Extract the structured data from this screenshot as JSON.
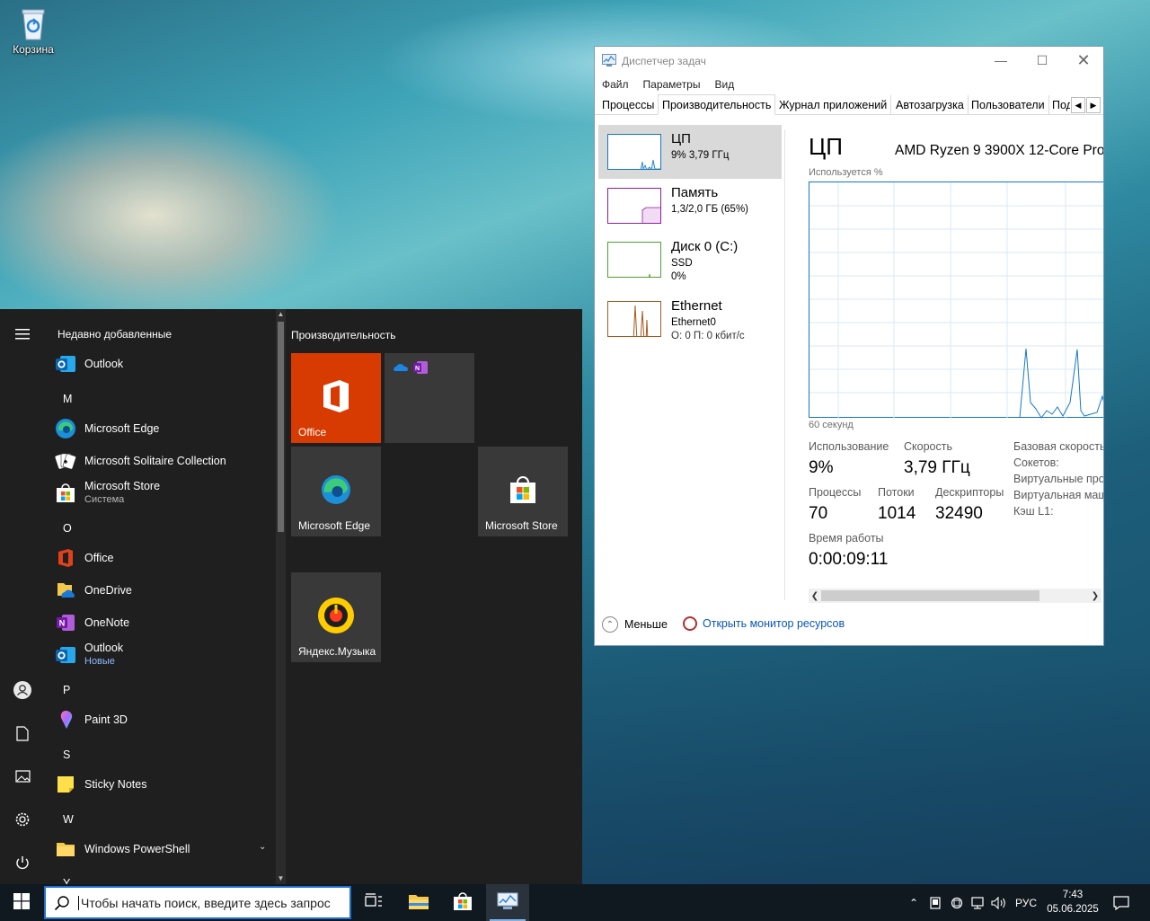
{
  "desktop": {
    "recycle_bin_label": "Корзина"
  },
  "start_menu": {
    "recently_added_header": "Недавно добавленные",
    "apps": [
      {
        "name": "Outlook",
        "icon": "outlook-icon"
      },
      {
        "letter": "M"
      },
      {
        "name": "Microsoft Edge",
        "icon": "edge-icon"
      },
      {
        "name": "Microsoft Solitaire Collection",
        "icon": "solitaire-icon"
      },
      {
        "name": "Microsoft Store",
        "sub": "Система",
        "icon": "store-icon"
      },
      {
        "letter": "O"
      },
      {
        "name": "Office",
        "icon": "office-icon"
      },
      {
        "name": "OneDrive",
        "icon": "onedrive-icon"
      },
      {
        "name": "OneNote",
        "icon": "onenote-icon"
      },
      {
        "name": "Outlook",
        "sub": "Новые",
        "icon": "outlook-icon"
      },
      {
        "letter": "P"
      },
      {
        "name": "Paint 3D",
        "icon": "paint3d-icon"
      },
      {
        "letter": "S"
      },
      {
        "name": "Sticky Notes",
        "icon": "sticky-notes-icon"
      },
      {
        "letter": "W"
      },
      {
        "name": "Windows PowerShell",
        "icon": "folder-icon"
      },
      {
        "letter": "Y"
      }
    ],
    "tiles_group": "Производительность",
    "tiles": {
      "office": "Office",
      "edge": "Microsoft Edge",
      "store": "Microsoft Store",
      "yandex_music": "Яндекс.Музыка"
    }
  },
  "taskbar": {
    "search_placeholder": "Чтобы начать поиск, введите здесь запрос",
    "language": "РУС",
    "time": "7:43",
    "date": "05.06.2025"
  },
  "task_manager": {
    "title": "Диспетчер задач",
    "menu": [
      "Файл",
      "Параметры",
      "Вид"
    ],
    "tabs": [
      "Процессы",
      "Производительность",
      "Журнал приложений",
      "Автозагрузка",
      "Пользователи",
      "Под"
    ],
    "selected_tab": "Производительность",
    "resources": [
      {
        "name": "ЦП",
        "line1": "9% 3,79 ГГц",
        "line2": "",
        "color": "#1378c2"
      },
      {
        "name": "Память",
        "line1": "1,3/2,0 ГБ (65%)",
        "line2": "",
        "color": "#8b1e9b"
      },
      {
        "name": "Диск 0 (C:)",
        "line1": "SSD",
        "line2": "0%",
        "color": "#4da12f"
      },
      {
        "name": "Ethernet",
        "line1": "Ethernet0",
        "line2": "О: 0 П: 0 кбит/с",
        "color": "#a75a1f"
      }
    ],
    "cpu": {
      "heading": "ЦП",
      "model": "AMD Ryzen 9 3900X 12-Core Pro",
      "graph_label": "Используется %",
      "graph_time": "60 секунд",
      "utilization_label": "Использование",
      "utilization": "9%",
      "speed_label": "Скорость",
      "speed": "3,79 ГГц",
      "processes_label": "Процессы",
      "processes": "70",
      "threads_label": "Потоки",
      "threads": "1014",
      "handles_label": "Дескрипторы",
      "handles": "32490",
      "uptime_label": "Время работы",
      "uptime": "0:00:09:11",
      "base_speed_label": "Базовая скорость:",
      "sockets_label": "Сокетов:",
      "virtual_proc_label": "Виртуальные проц",
      "virtual_machine_label": "Виртуальная маш",
      "l1_cache_label": "Кэш L1:"
    },
    "fewer_details": "Меньше",
    "open_resource_monitor": "Открыть монитор ресурсов"
  }
}
